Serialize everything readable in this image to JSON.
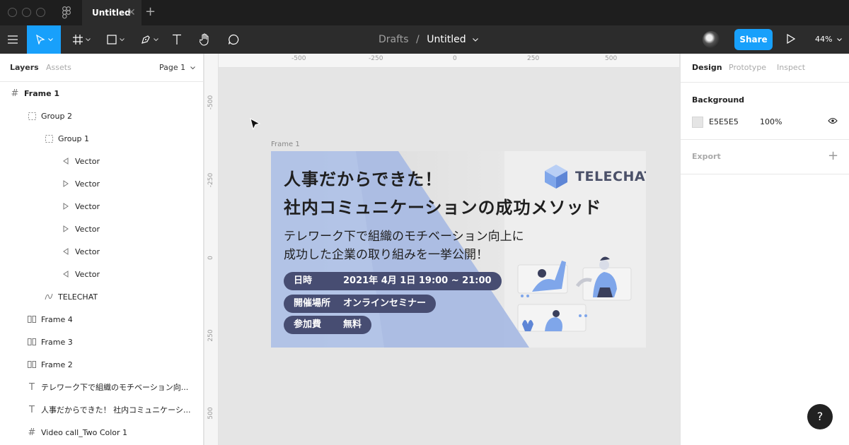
{
  "titlebar": {
    "tab_title": "Untitled",
    "tab_close": "✕",
    "tab_add": "+"
  },
  "toolbar": {
    "breadcrumb_parent": "Drafts",
    "breadcrumb_sep": "/",
    "file_name": "Untitled",
    "share_label": "Share",
    "zoom_label": "44%"
  },
  "left_panel": {
    "tab_layers": "Layers",
    "tab_assets": "Assets",
    "page_selector": "Page 1",
    "layers": [
      {
        "name": "Frame 1",
        "icon": "frame-icon"
      },
      {
        "name": "Group 2",
        "icon": "group-icon"
      },
      {
        "name": "Group 1",
        "icon": "group-icon"
      },
      {
        "name": "Vector",
        "icon": "vector-left-icon"
      },
      {
        "name": "Vector",
        "icon": "vector-right-icon"
      },
      {
        "name": "Vector",
        "icon": "vector-right-icon"
      },
      {
        "name": "Vector",
        "icon": "vector-right-icon"
      },
      {
        "name": "Vector",
        "icon": "vector-left-icon"
      },
      {
        "name": "Vector",
        "icon": "vector-left-icon"
      },
      {
        "name": "TELECHAT",
        "icon": "path-icon"
      },
      {
        "name": "Frame 4",
        "icon": "columns-icon"
      },
      {
        "name": "Frame 3",
        "icon": "columns-icon"
      },
      {
        "name": "Frame 2",
        "icon": "columns-icon"
      },
      {
        "name": "テレワーク下で組織のモチベーション向...",
        "icon": "text-icon"
      },
      {
        "name": "人事だからできた！ 社内コミュニケーシ...",
        "icon": "text-icon"
      },
      {
        "name": "Video call_Two Color 1",
        "icon": "frame-icon"
      }
    ]
  },
  "canvas": {
    "h_ruler": [
      "-500",
      "-250",
      "0",
      "250",
      "500"
    ],
    "v_ruler": [
      "-500",
      "-250",
      "0",
      "250",
      "500"
    ],
    "frame_label": "Frame 1",
    "banner": {
      "headline_1": "人事だからできた！",
      "headline_2": "社内コミュニケーションの成功メソッド",
      "sub_1": "テレワーク下で組織のモチベーション向上に",
      "sub_2": "成功した企業の取り組みを一挙公開！",
      "brand": "TELECHAT",
      "pills": [
        {
          "key": "日時",
          "value": "2021年 4月 1日 19:00 ~ 21:00"
        },
        {
          "key": "開催場所",
          "value": "オンラインセミナー"
        },
        {
          "key": "参加費",
          "value": "無料"
        }
      ]
    }
  },
  "right_panel": {
    "tab_design": "Design",
    "tab_prototype": "Prototype",
    "tab_inspect": "Inspect",
    "background_title": "Background",
    "bg_hex": "E5E5E5",
    "bg_opacity": "100%",
    "export_title": "Export",
    "export_add": "+"
  },
  "help_label": "?",
  "colors": {
    "accent": "#18a0fb",
    "canvas_bg": "#e5e5e5",
    "pill": "#474d72",
    "banner_blue": "#9fb4df"
  }
}
